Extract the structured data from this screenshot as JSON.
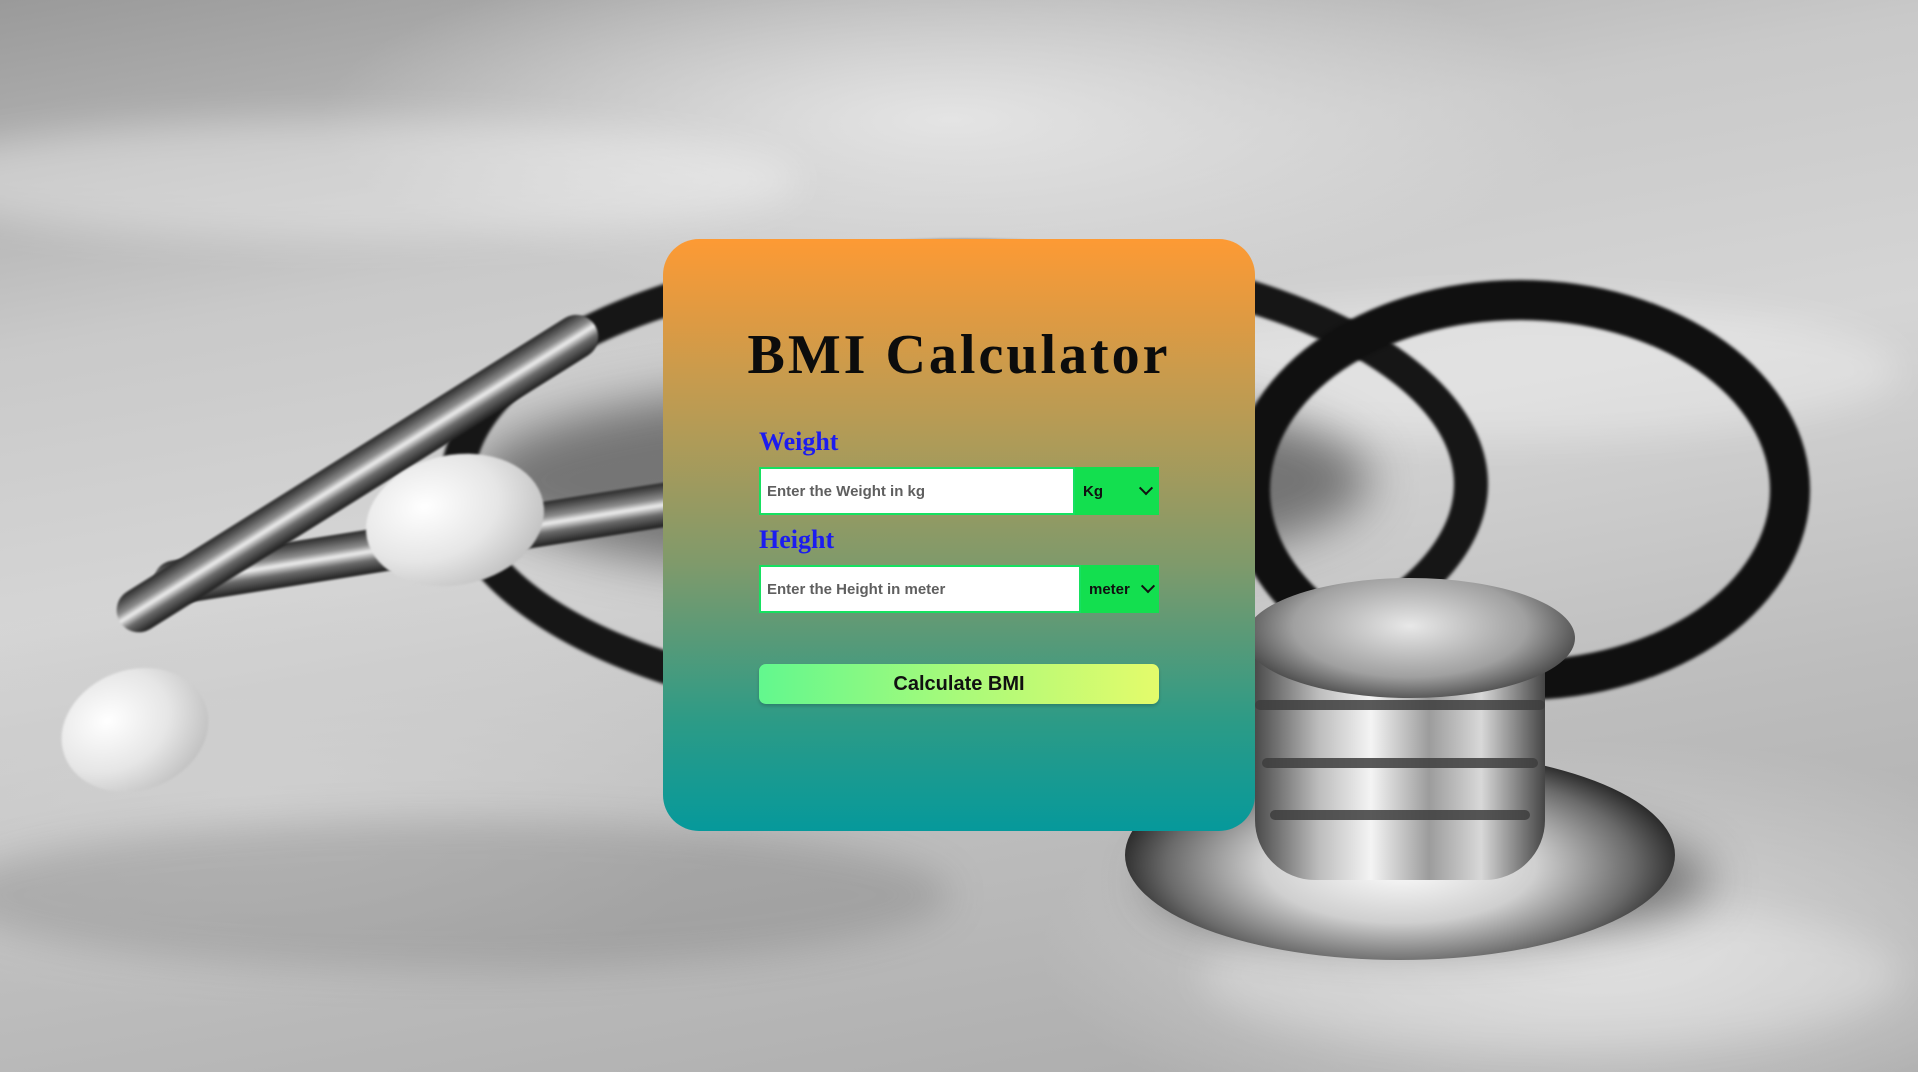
{
  "page": {
    "title": "BMI Calculator"
  },
  "form": {
    "weight": {
      "label": "Weight",
      "placeholder": "Enter the Weight in kg",
      "value": "",
      "unit": "Kg"
    },
    "height": {
      "label": "Height",
      "placeholder": "Enter the Height in meter",
      "value": "",
      "unit": "meter"
    },
    "submit_label": "Calculate BMI"
  },
  "theme": {
    "card_gradient_top": "#fd9a34",
    "card_gradient_bottom": "#06999b",
    "label_color": "#1c1cf0",
    "select_color": "#13df4f",
    "button_gradient_start": "#62f88e",
    "button_gradient_end": "#e4fb6b"
  },
  "icons": {
    "unit_dropdown": "chevron-down-icon",
    "background": "stethoscope-photo"
  }
}
